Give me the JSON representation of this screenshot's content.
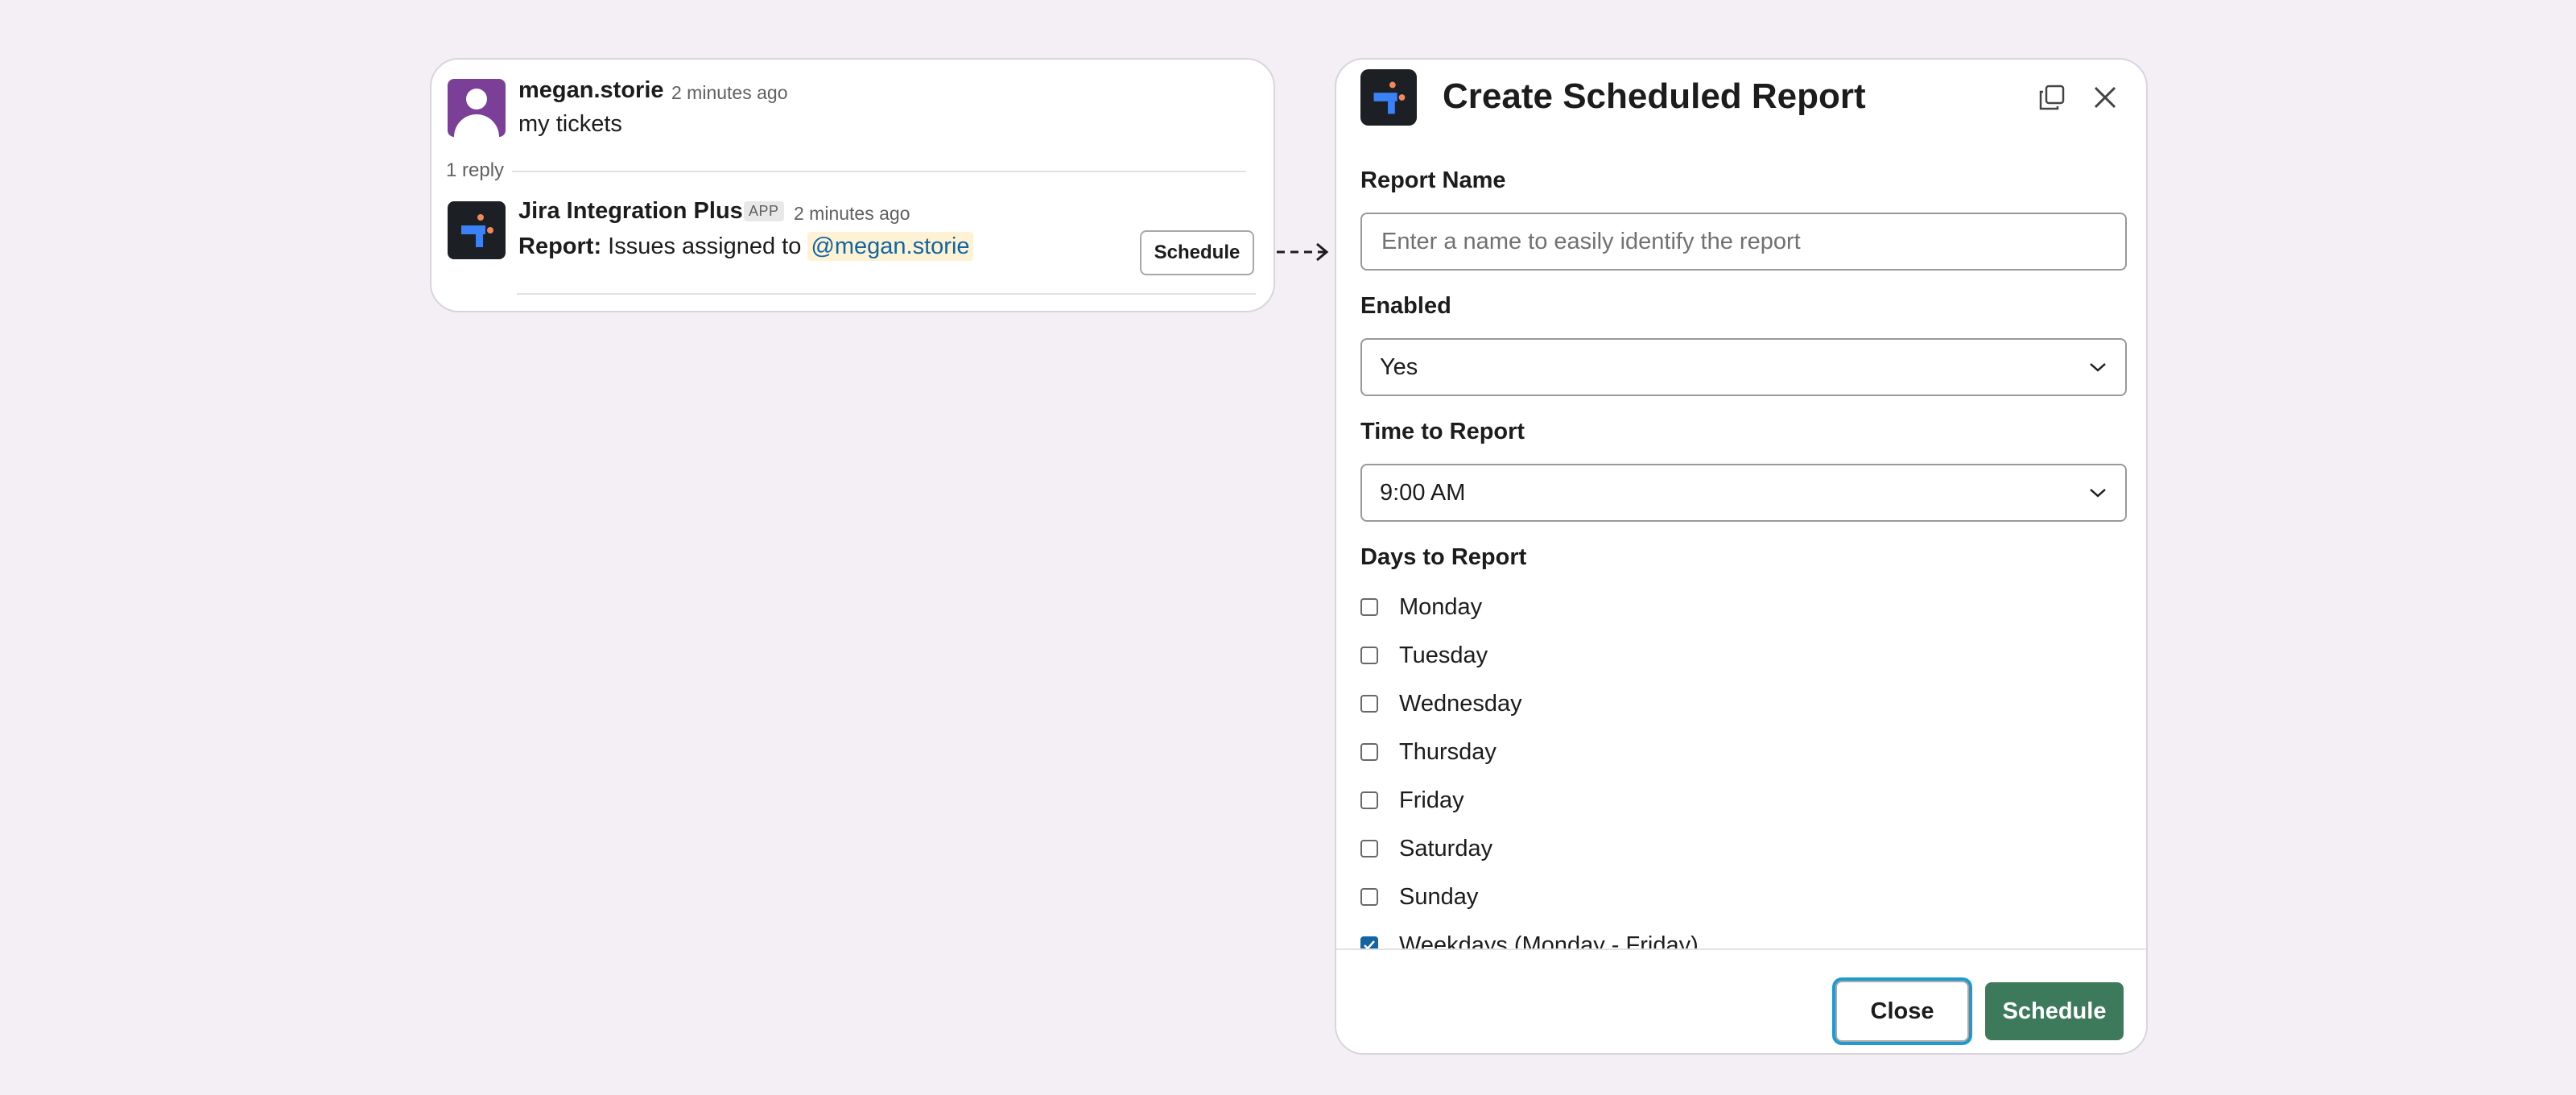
{
  "message": {
    "author": "megan.storie",
    "time": "2 minutes ago",
    "text": "my tickets",
    "reply_count": "1 reply"
  },
  "reply": {
    "app_name": "Jira Integration Plus",
    "badge": "APP",
    "time": "2 minutes ago",
    "report_label": "Report:",
    "report_text": "Issues assigned to",
    "mention": "@megan.storie",
    "schedule_button": "Schedule"
  },
  "modal": {
    "title": "Create Scheduled Report",
    "report_name": {
      "label": "Report Name",
      "value": "",
      "placeholder": "Enter a name to easily identify the report"
    },
    "enabled": {
      "label": "Enabled",
      "selected": "Yes"
    },
    "time": {
      "label": "Time to Report",
      "selected": "9:00 AM"
    },
    "days": {
      "label": "Days to Report",
      "options": [
        {
          "label": "Monday",
          "checked": false
        },
        {
          "label": "Tuesday",
          "checked": false
        },
        {
          "label": "Wednesday",
          "checked": false
        },
        {
          "label": "Thursday",
          "checked": false
        },
        {
          "label": "Friday",
          "checked": false
        },
        {
          "label": "Saturday",
          "checked": false
        },
        {
          "label": "Sunday",
          "checked": false
        },
        {
          "label": "Weekdays (Monday - Friday)",
          "checked": true
        }
      ]
    },
    "footer": {
      "close_label": "Close",
      "schedule_label": "Schedule"
    }
  },
  "colors": {
    "background": "#f3eff5",
    "user_avatar": "#7b3f98",
    "primary_button": "#3d7a5c",
    "mention_bg": "#fdf3d4",
    "mention_text": "#1264a3",
    "checkbox_checked": "#1264a3"
  },
  "icons": [
    "user-avatar-icon",
    "app-logo-icon",
    "dashed-arrow-icon",
    "expand-window-icon",
    "close-icon",
    "chevron-down-icon",
    "checkmark-icon"
  ]
}
